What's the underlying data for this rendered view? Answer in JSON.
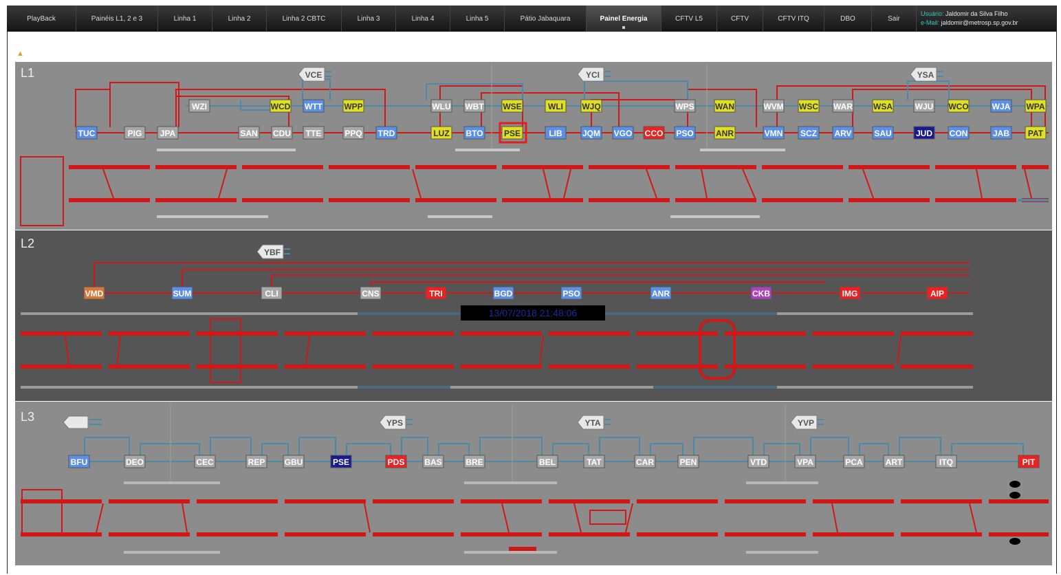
{
  "nav": {
    "tabs": [
      "PlayBack",
      "Painéis L1, 2 e 3",
      "Linha 1",
      "Linha 2",
      "Linha 2 CBTC",
      "Linha 3",
      "Linha 4",
      "Linha 5",
      "Pátio Jabaquara",
      "Painel Energia",
      "CFTV L5",
      "CFTV",
      "CFTV ITQ",
      "DBO",
      "Sair"
    ],
    "active_index": 9,
    "user_label": "Usuário:",
    "user_name": "Jaldomir da Silva Filho",
    "email_label": "e-Mail:",
    "email": "jaldomir@metrosp.sp.gov.br"
  },
  "warning_icon": "warning-triangle-icon",
  "colors": {
    "panel_light": "#8c8c8c",
    "panel_dark": "#555555",
    "track_red": "#d01818",
    "feeder_blue": "#4a8aa8",
    "station_blue": "#5b8fe8",
    "station_yellow": "#e0e020",
    "station_red": "#ee2020",
    "station_gray": "#a8a8a8",
    "station_navy": "#1a1a90",
    "station_purple": "#b040c0",
    "station_orange": "#d87838"
  },
  "lines": [
    {
      "name": "L1",
      "substations": [
        "VCE",
        "YCI",
        "YSA"
      ],
      "upper_stations": [
        {
          "code": "WZI",
          "color": "gray"
        },
        {
          "code": "WCD",
          "color": "yellow"
        },
        {
          "code": "WTT",
          "color": "blue"
        },
        {
          "code": "WPP",
          "color": "yellow"
        },
        {
          "code": "WLU",
          "color": "gray"
        },
        {
          "code": "WBT",
          "color": "gray"
        },
        {
          "code": "WSE",
          "color": "yellow"
        },
        {
          "code": "WLI",
          "color": "yellow"
        },
        {
          "code": "WJQ",
          "color": "yellow"
        },
        {
          "code": "WPS",
          "color": "gray"
        },
        {
          "code": "WAN",
          "color": "yellow"
        },
        {
          "code": "WVM",
          "color": "gray"
        },
        {
          "code": "WSC",
          "color": "yellow"
        },
        {
          "code": "WAR",
          "color": "gray"
        },
        {
          "code": "WSA",
          "color": "yellow"
        },
        {
          "code": "WJU",
          "color": "gray"
        },
        {
          "code": "WCO",
          "color": "yellow"
        },
        {
          "code": "WJA",
          "color": "blue"
        },
        {
          "code": "WPA",
          "color": "yellow"
        }
      ],
      "stations": [
        {
          "code": "TUC",
          "color": "blue"
        },
        {
          "code": "PIG",
          "color": "gray"
        },
        {
          "code": "JPA",
          "color": "gray"
        },
        {
          "code": "SAN",
          "color": "gray"
        },
        {
          "code": "CDU",
          "color": "gray"
        },
        {
          "code": "TTE",
          "color": "gray"
        },
        {
          "code": "PPQ",
          "color": "gray"
        },
        {
          "code": "TRD",
          "color": "blue"
        },
        {
          "code": "LUZ",
          "color": "yellow"
        },
        {
          "code": "BTO",
          "color": "blue"
        },
        {
          "code": "PSE",
          "color": "yellow"
        },
        {
          "code": "LIB",
          "color": "blue"
        },
        {
          "code": "JQM",
          "color": "blue"
        },
        {
          "code": "VGO",
          "color": "blue"
        },
        {
          "code": "CCO",
          "color": "red"
        },
        {
          "code": "PSO",
          "color": "blue"
        },
        {
          "code": "ANR",
          "color": "yellow"
        },
        {
          "code": "VMN",
          "color": "blue"
        },
        {
          "code": "SCZ",
          "color": "blue"
        },
        {
          "code": "ARV",
          "color": "blue"
        },
        {
          "code": "SAU",
          "color": "blue"
        },
        {
          "code": "JUD",
          "color": "navy"
        },
        {
          "code": "CON",
          "color": "blue"
        },
        {
          "code": "JAB",
          "color": "blue"
        },
        {
          "code": "PAT",
          "color": "yellow"
        }
      ]
    },
    {
      "name": "L2",
      "substations": [
        "YBF"
      ],
      "stations": [
        {
          "code": "VMD",
          "color": "orange"
        },
        {
          "code": "SUM",
          "color": "blue"
        },
        {
          "code": "CLI",
          "color": "gray"
        },
        {
          "code": "CNS",
          "color": "gray"
        },
        {
          "code": "TRI",
          "color": "red"
        },
        {
          "code": "BGD",
          "color": "blue"
        },
        {
          "code": "PSO",
          "color": "blue"
        },
        {
          "code": "ANR",
          "color": "blue"
        },
        {
          "code": "CKB",
          "color": "purple"
        },
        {
          "code": "IMG",
          "color": "red"
        },
        {
          "code": "AIP",
          "color": "red"
        }
      ],
      "clock": "13/07/2018 21:48:06"
    },
    {
      "name": "L3",
      "substations": [
        "YPS",
        "YTA",
        "YVP"
      ],
      "stations": [
        {
          "code": "BFU",
          "color": "blue"
        },
        {
          "code": "DEO",
          "color": "gray"
        },
        {
          "code": "CEC",
          "color": "gray"
        },
        {
          "code": "REP",
          "color": "gray"
        },
        {
          "code": "GBU",
          "color": "gray"
        },
        {
          "code": "PSE",
          "color": "navy"
        },
        {
          "code": "PDS",
          "color": "red"
        },
        {
          "code": "BAS",
          "color": "gray"
        },
        {
          "code": "BRE",
          "color": "gray"
        },
        {
          "code": "BEL",
          "color": "gray"
        },
        {
          "code": "TAT",
          "color": "gray"
        },
        {
          "code": "CAR",
          "color": "gray"
        },
        {
          "code": "PEN",
          "color": "gray"
        },
        {
          "code": "VTD",
          "color": "gray"
        },
        {
          "code": "VPA",
          "color": "gray"
        },
        {
          "code": "PCA",
          "color": "gray"
        },
        {
          "code": "ART",
          "color": "gray"
        },
        {
          "code": "ITQ",
          "color": "gray"
        },
        {
          "code": "PIT",
          "color": "red"
        }
      ]
    }
  ]
}
